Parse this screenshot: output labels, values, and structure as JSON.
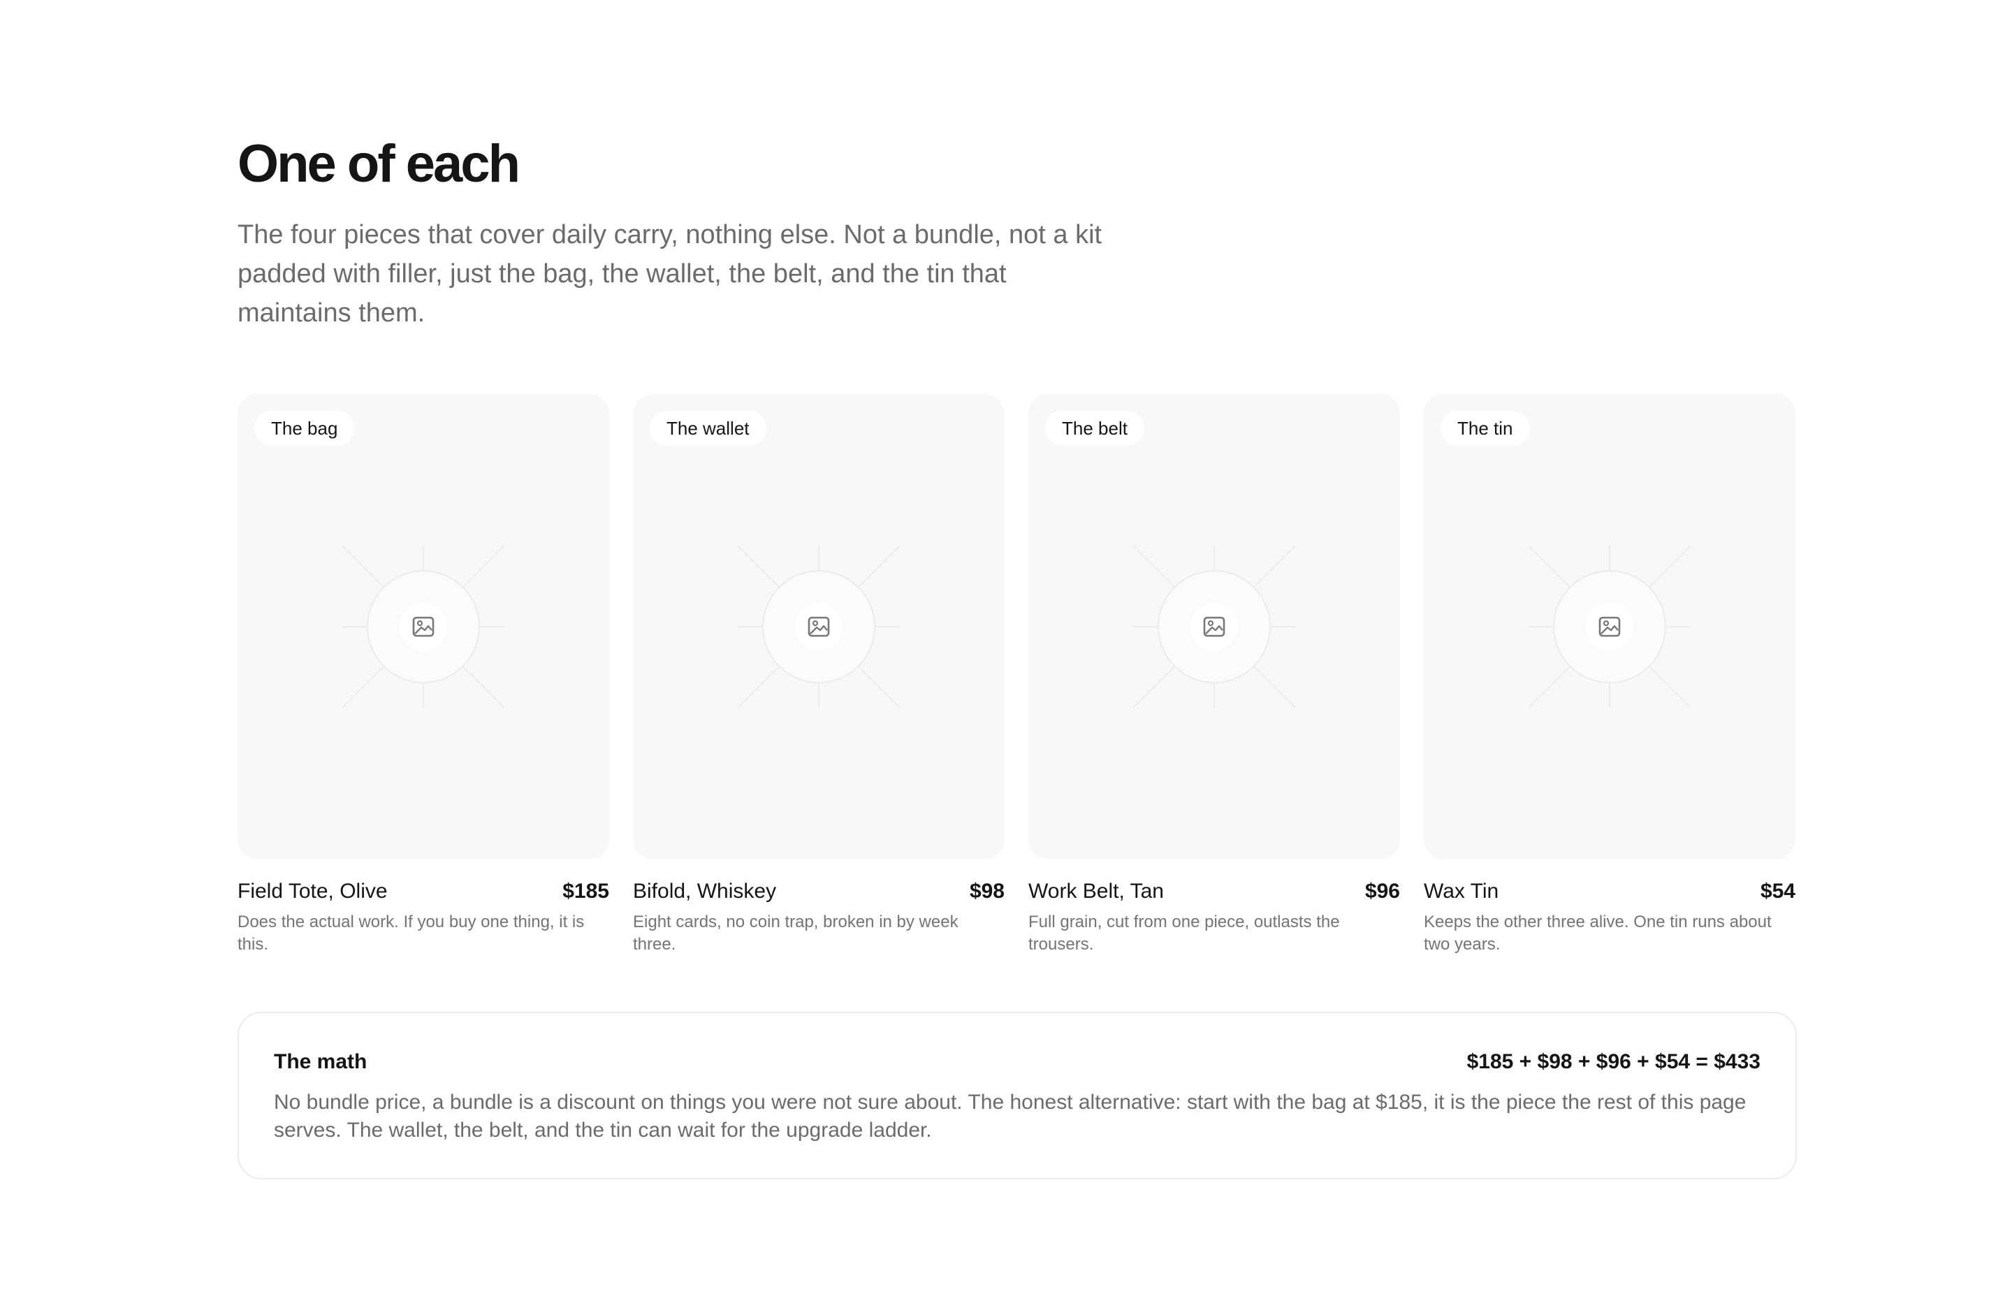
{
  "header": {
    "title": "One of each",
    "intro": "The four pieces that cover daily carry, nothing else. Not a bundle, not a kit padded with filler, just the bag, the wallet, the belt, and the tin that maintains them."
  },
  "products": [
    {
      "tag": "The bag",
      "name": "Field Tote, Olive",
      "price": "$185",
      "description": "Does the actual work. If you buy one thing, it is this.",
      "icon": "image-placeholder-icon"
    },
    {
      "tag": "The wallet",
      "name": "Bifold, Whiskey",
      "price": "$98",
      "description": "Eight cards, no coin trap, broken in by week three.",
      "icon": "image-placeholder-icon"
    },
    {
      "tag": "The belt",
      "name": "Work Belt, Tan",
      "price": "$96",
      "description": "Full grain, cut from one piece, outlasts the trousers.",
      "icon": "image-placeholder-icon"
    },
    {
      "tag": "The tin",
      "name": "Wax Tin",
      "price": "$54",
      "description": "Keeps the other three alive. One tin runs about two years.",
      "icon": "image-placeholder-icon"
    }
  ],
  "math": {
    "title": "The math",
    "sum": "$185 + $98 + $96 + $54 = $433",
    "body": "No bundle price, a bundle is a discount on things you were not sure about. The honest alternative: start with the bag at $185, it is the piece the rest of this page serves. The wallet, the belt, and the tin can wait for the upgrade ladder."
  },
  "colors": {
    "text": "#151515",
    "muted": "#6b6b6b",
    "card_bg": "#f8f8f8",
    "border": "#ececec"
  }
}
